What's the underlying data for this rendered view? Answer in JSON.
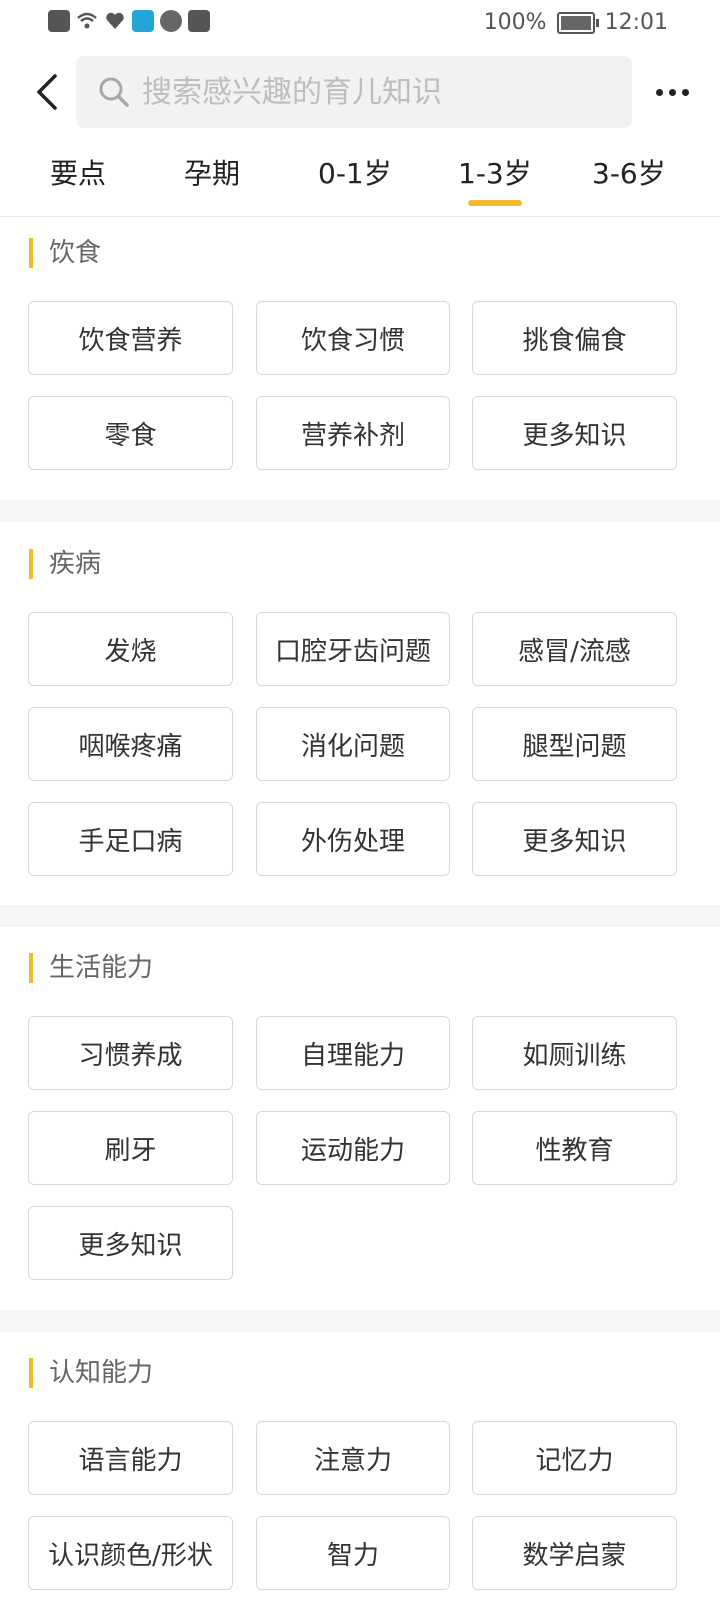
{
  "status": {
    "battery": "100%",
    "time": "12:01"
  },
  "search": {
    "placeholder": "搜索感兴趣的育儿知识"
  },
  "tabs": [
    "要点",
    "孕期",
    "0-1岁",
    "1-3岁",
    "3-6岁"
  ],
  "active_tab": "1-3岁",
  "sections": [
    {
      "title": "饮食",
      "tags": [
        "饮食营养",
        "饮食习惯",
        "挑食偏食",
        "零食",
        "营养补剂",
        "更多知识"
      ]
    },
    {
      "title": "疾病",
      "tags": [
        "发烧",
        "口腔牙齿问题",
        "感冒/流感",
        "咽喉疼痛",
        "消化问题",
        "腿型问题",
        "手足口病",
        "外伤处理",
        "更多知识"
      ]
    },
    {
      "title": "生活能力",
      "tags": [
        "习惯养成",
        "自理能力",
        "如厕训练",
        "刷牙",
        "运动能力",
        "性教育",
        "更多知识"
      ]
    },
    {
      "title": "认知能力",
      "tags": [
        "语言能力",
        "注意力",
        "记忆力",
        "认识颜色/形状",
        "智力",
        "数学启蒙"
      ]
    }
  ],
  "colors": {
    "accent": "#f5b92a",
    "divider": "#f5f5f5"
  }
}
